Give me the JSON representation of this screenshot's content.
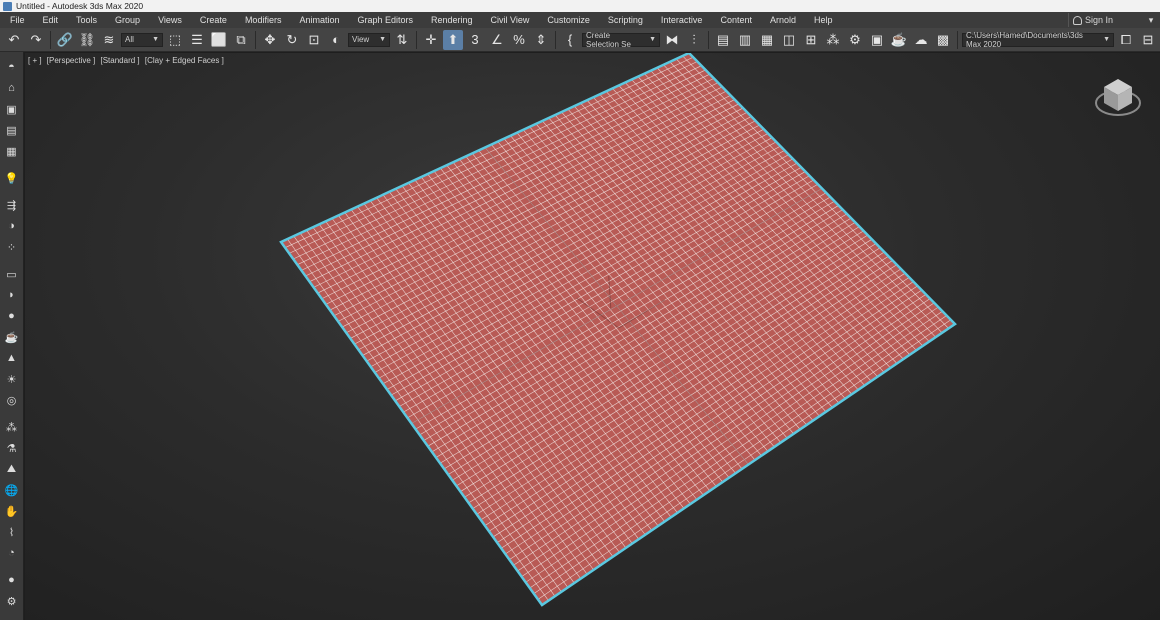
{
  "window": {
    "title": "Untitled - Autodesk 3ds Max 2020"
  },
  "menu": [
    "File",
    "Edit",
    "Tools",
    "Group",
    "Views",
    "Create",
    "Modifiers",
    "Animation",
    "Graph Editors",
    "Rendering",
    "Civil View",
    "Customize",
    "Scripting",
    "Interactive",
    "Content",
    "Arnold",
    "Help"
  ],
  "account": {
    "sign_in": "Sign In"
  },
  "toolbar": {
    "filter_value": "All",
    "coord_value": "View",
    "selection_set": "Create Selection Se",
    "project_path": "C:\\Users\\Hamed\\Documents\\3ds Max 2020"
  },
  "viewport": {
    "label_plus": "[ + ]",
    "label_view": "[Perspective ]",
    "label_shading": "[Standard ]",
    "label_style": "[Clay + Edged Faces ]"
  },
  "colors": {
    "plane_fill": "#b85a55",
    "plane_outline": "#5ac8e0",
    "grid_line": "#f3e7e5",
    "accent": "#5b7fa6"
  },
  "icons": {
    "left_panel": [
      "view-icon",
      "create-icon",
      "modify-icon",
      "hierarchy-icon",
      "motion-icon",
      "light-icon",
      "camera-icon",
      "helpers-icon",
      "box-icon",
      "sphere-icon",
      "torus-icon",
      "cone-icon",
      "teapot-icon",
      "sun-icon",
      "geosphere-icon",
      "particles-icon",
      "material-icon",
      "render-icon",
      "globe-icon",
      "hand-icon",
      "tool-icon",
      "paint-icon",
      "shader-ball-icon",
      "layer-icon"
    ]
  }
}
